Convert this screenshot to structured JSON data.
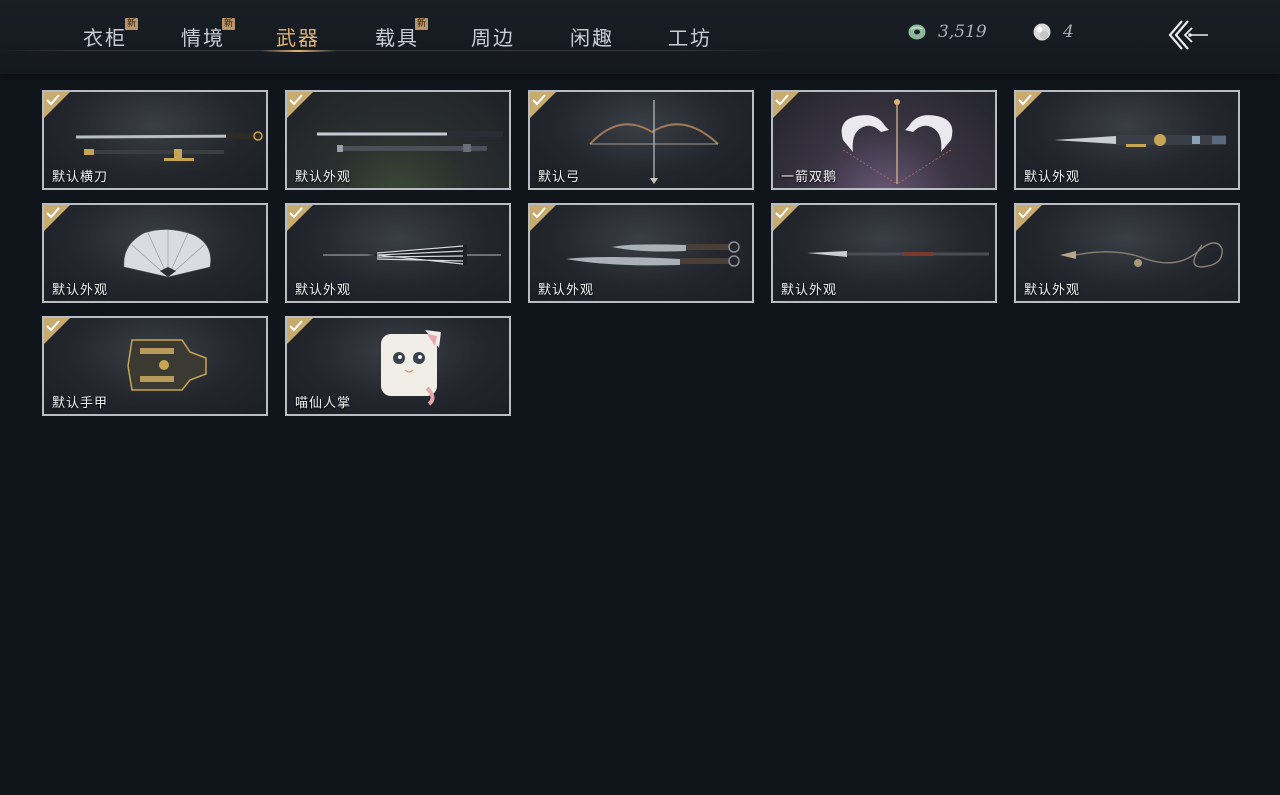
{
  "nav": {
    "tabs": [
      {
        "label": "衣柜",
        "new": true,
        "badge": "新"
      },
      {
        "label": "情境",
        "new": true,
        "badge": "新"
      },
      {
        "label": "武器",
        "active": true
      },
      {
        "label": "载具",
        "new": true,
        "badge": "新"
      },
      {
        "label": "周边"
      },
      {
        "label": "闲趣"
      },
      {
        "label": "工坊"
      }
    ]
  },
  "currency": {
    "jade": {
      "icon": "jade-coin-icon",
      "value": "3,519",
      "color": "#8fb89a"
    },
    "pearl": {
      "icon": "pearl-icon",
      "value": "4",
      "color": "#e6e6e6"
    }
  },
  "back": {
    "icon": "back-arrow-icon"
  },
  "items": [
    {
      "label": "默认横刀",
      "icon": "dao-sword-icon",
      "equipped": true
    },
    {
      "label": "默认外观",
      "icon": "long-sword-icon",
      "equipped": true
    },
    {
      "label": "默认弓",
      "icon": "bow-icon",
      "equipped": true
    },
    {
      "label": "一箭双鹅",
      "icon": "goose-bow-icon",
      "equipped": true
    },
    {
      "label": "默认外观",
      "icon": "ornate-blade-icon",
      "equipped": true
    },
    {
      "label": "默认外观",
      "icon": "fan-icon",
      "equipped": true
    },
    {
      "label": "默认外观",
      "icon": "umbrella-icon",
      "equipped": true
    },
    {
      "label": "默认外观",
      "icon": "twin-blades-icon",
      "equipped": true
    },
    {
      "label": "默认外观",
      "icon": "spear-icon",
      "equipped": true
    },
    {
      "label": "默认外观",
      "icon": "rope-dart-icon",
      "equipped": true
    },
    {
      "label": "默认手甲",
      "icon": "gauntlet-icon",
      "equipped": true
    },
    {
      "label": "喵仙人掌",
      "icon": "cat-paw-icon",
      "equipped": true
    }
  ],
  "colors": {
    "accent_gold": "#e0b56f",
    "card_border": "#b9bdc3",
    "background": "#10141b"
  }
}
